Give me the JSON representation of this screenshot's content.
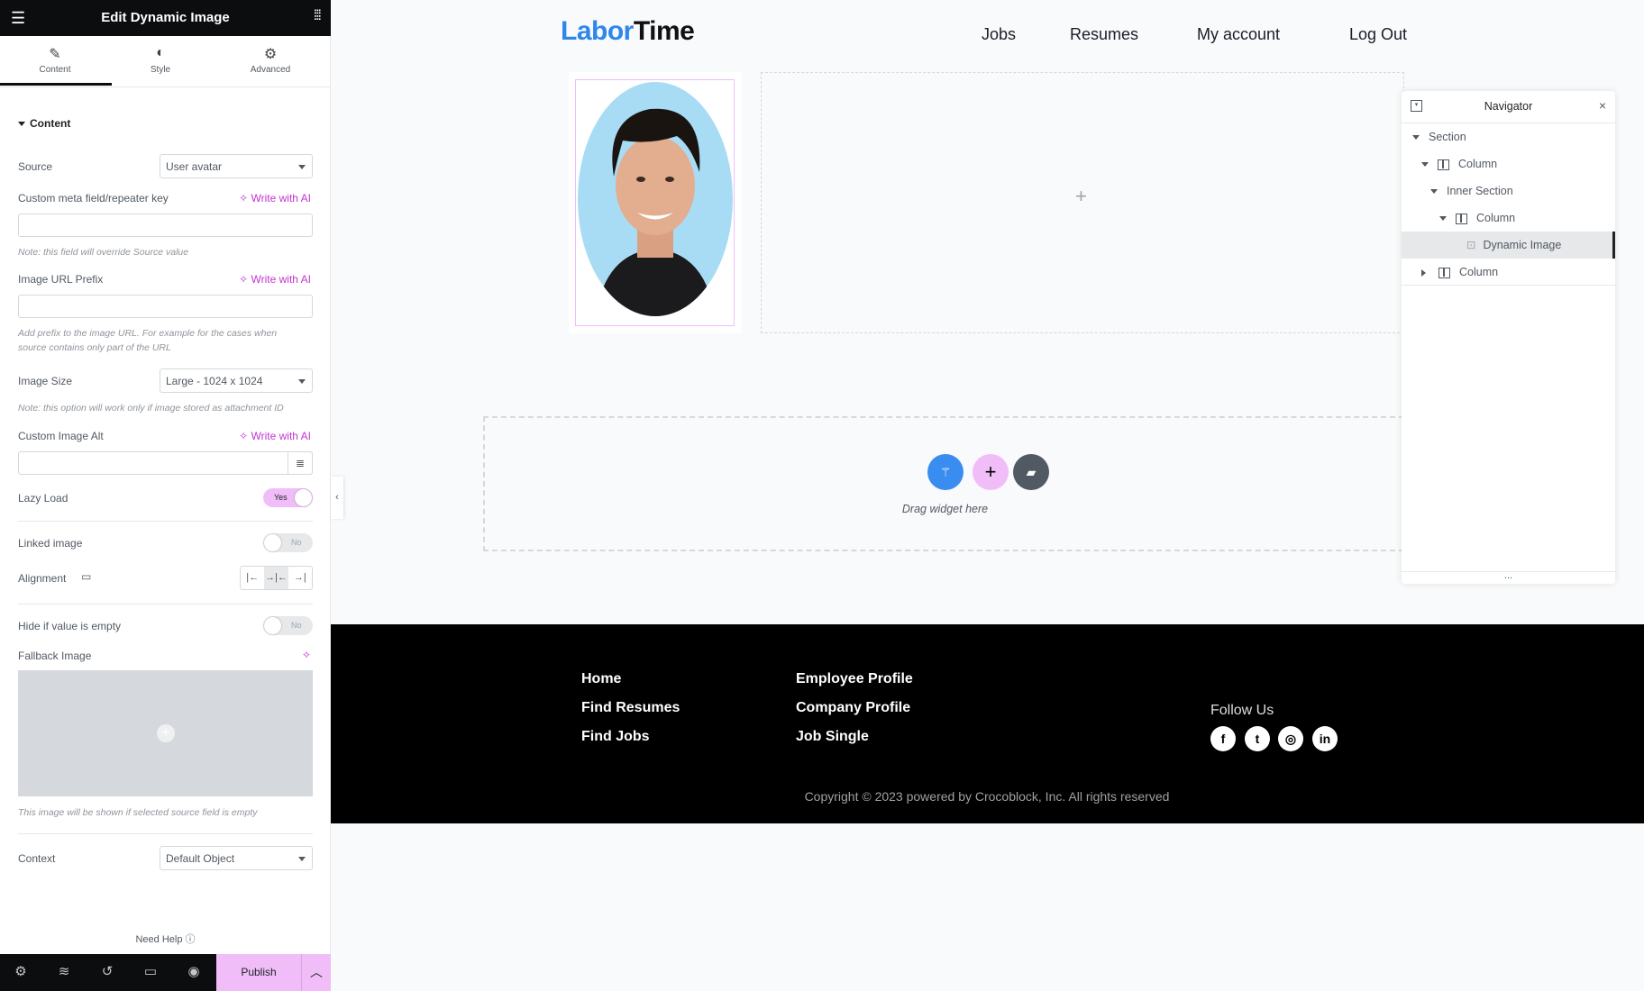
{
  "panel": {
    "title": "Edit Dynamic Image",
    "tabs": [
      {
        "label": "Content",
        "icon": "pencil-icon"
      },
      {
        "label": "Style",
        "icon": "contrast-icon"
      },
      {
        "label": "Advanced",
        "icon": "gear-icon"
      }
    ],
    "section_title": "Content",
    "source": {
      "label": "Source",
      "value": "User avatar"
    },
    "custom_meta": {
      "label": "Custom meta field/repeater key",
      "ai": "Write with AI",
      "value": "",
      "note": "Note: this field will override Source value"
    },
    "url_prefix": {
      "label": "Image URL Prefix",
      "ai": "Write with AI",
      "value": "",
      "note": "Add prefix to the image URL. For example for the cases when source contains only part of the URL"
    },
    "image_size": {
      "label": "Image Size",
      "value": "Large - 1024 x 1024",
      "note": "Note: this option will work only if image stored as attachment ID"
    },
    "image_alt": {
      "label": "Custom Image Alt",
      "ai": "Write with AI",
      "value": ""
    },
    "lazy_load": {
      "label": "Lazy Load",
      "value": "Yes"
    },
    "linked_image": {
      "label": "Linked image",
      "value": "No"
    },
    "alignment": {
      "label": "Alignment",
      "selected": "center"
    },
    "hide_empty": {
      "label": "Hide if value is empty",
      "value": "No"
    },
    "fallback": {
      "label": "Fallback Image",
      "note": "This image will be shown if selected source field is empty"
    },
    "context": {
      "label": "Context",
      "value": "Default Object"
    },
    "need_help": "Need Help",
    "publish": "Publish"
  },
  "site": {
    "logo_a": "Labor",
    "logo_b": "Time",
    "nav": [
      "Jobs",
      "Resumes",
      "My account",
      "Log Out"
    ],
    "drag_text": "Drag widget here",
    "footer_col1": [
      "Home",
      "Find Resumes",
      "Find Jobs"
    ],
    "footer_col2": [
      "Employee Profile",
      "Company Profile",
      "Job Single"
    ],
    "follow": "Follow Us",
    "social": [
      "facebook",
      "twitter",
      "instagram",
      "linkedin"
    ],
    "copyright": "Copyright © 2023 powered by Crocoblock, Inc. All rights reserved"
  },
  "navigator": {
    "title": "Navigator",
    "items": [
      "Section",
      "Column",
      "Inner Section",
      "Column",
      "Dynamic Image",
      "Column"
    ],
    "selected": "Dynamic Image",
    "more": "..."
  },
  "colors": {
    "accent": "#f0bdf9",
    "ai": "#c036d1",
    "logo_blue": "#2f86eb",
    "footer": "#000000"
  }
}
